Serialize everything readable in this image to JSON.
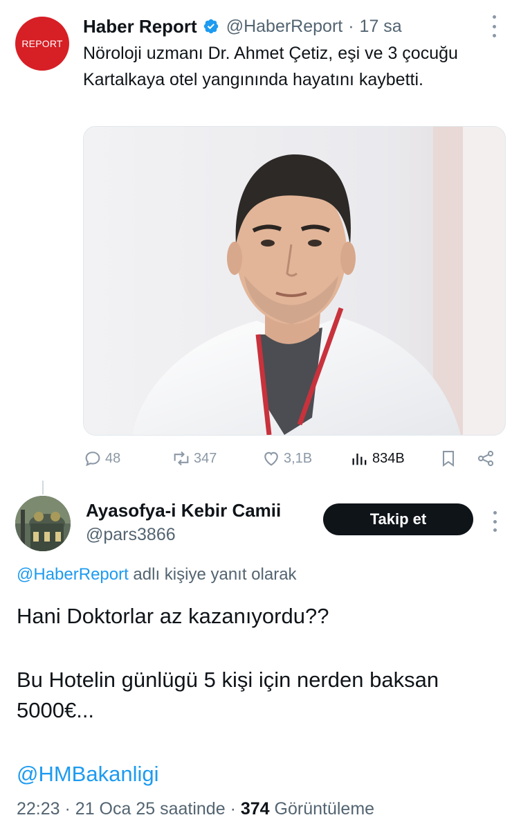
{
  "original_tweet": {
    "avatar_text": "REPORT",
    "display_name": "Haber Report",
    "handle": "@HaberReport",
    "separator": "·",
    "time": "17 sa",
    "text": "Nöroloji uzmanı Dr. Ahmet Çetiz, eşi ve 3 çocuğu Kartalkaya otel yangınında hayatını kaybetti.",
    "stats": {
      "replies": "48",
      "reposts": "347",
      "likes": "3,1B",
      "views": "834B"
    }
  },
  "reply": {
    "display_name": "Ayasofya-i Kebir Camii",
    "handle": "@pars3866",
    "follow_label": "Takip et",
    "replying_mention": "@HaberReport",
    "replying_suffix": " adlı kişiye yanıt olarak",
    "line1": "Hani Doktorlar az kazanıyordu??",
    "line2": "Bu Hotelin günlügü 5 kişi için nerden baksan 5000€...",
    "tag": "@HMBakanligi",
    "time": "22:23",
    "date": "21 Oca 25 saatinde",
    "separator": "·",
    "view_count": "374",
    "view_label": "Görüntüleme"
  },
  "colors": {
    "brand_red": "#d71f26",
    "link_blue": "#1d9bf0",
    "muted_text": "#536471",
    "primary_text": "#0f1419",
    "verified_blue": "#1d9bf0"
  },
  "icons": [
    "verified-badge-icon",
    "more-options-icon",
    "reply-icon",
    "repost-icon",
    "like-icon",
    "views-icon",
    "bookmark-icon",
    "share-icon"
  ]
}
